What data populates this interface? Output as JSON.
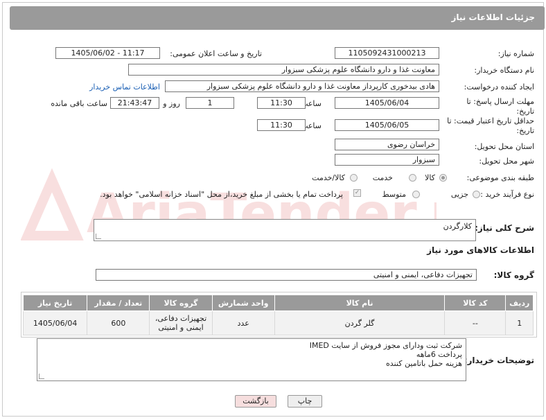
{
  "header": {
    "title": "جزئیات اطلاعات نیاز"
  },
  "form": {
    "need_number": {
      "label": "شماره نیاز:",
      "value": "1105092431000213"
    },
    "announce": {
      "label": "تاریخ و ساعت اعلان عمومی:",
      "value": "1405/06/02 - 11:17"
    },
    "buyer_org": {
      "label": "نام دستگاه خریدار:",
      "value": "معاونت غذا و دارو   دانشگاه علوم پزشکی سبزوار"
    },
    "creator": {
      "label": "ایجاد کننده درخواست:",
      "value": "هادی بیدخوری کارپرداز معاونت غذا و دارو   دانشگاه علوم پزشکی سبزوار",
      "contact_link": "اطلاعات تماس خریدار"
    },
    "deadline": {
      "label": "مهلت ارسال پاسخ: تا تاریخ:",
      "date": "1405/06/04",
      "time_label": "ساعت",
      "time": "11:30",
      "days": "1",
      "days_label": "روز و",
      "remaining": "21:43:47",
      "remaining_label": "ساعت باقی مانده"
    },
    "price_validity": {
      "label": "حداقل تاریخ اعتبار قیمت: تا تاریخ:",
      "date": "1405/06/05",
      "time_label": "ساعت",
      "time": "11:30"
    },
    "province": {
      "label": "استان محل تحویل:",
      "value": "خراسان رضوی"
    },
    "city": {
      "label": "شهر محل تحویل:",
      "value": "سبزوار"
    },
    "category": {
      "label": "طبقه بندی موضوعی:",
      "options": [
        "کالا",
        "خدمت",
        "کالا/خدمت"
      ],
      "selected": "کالا"
    },
    "process": {
      "label": "نوع فرآیند خرید :",
      "options": [
        "جزیی",
        "متوسط"
      ],
      "note": "پرداخت تمام یا بخشی از مبلغ خرید،از محل \"اسناد خزانه اسلامی\" خواهد بود."
    }
  },
  "description": {
    "label": "شرح کلی نیاز:",
    "value": "کلارگردن"
  },
  "goods": {
    "section_title": "اطلاعات کالاهای مورد نیاز",
    "group_label": "گروه کالا:",
    "group_value": "تجهیزات دفاعی، ایمنی و امنیتی",
    "columns": [
      "ردیف",
      "کد کالا",
      "نام کالا",
      "واحد شمارش",
      "گروه کالا",
      "تعداد / مقدار",
      "تاریخ نیاز"
    ],
    "rows": [
      {
        "index": "1",
        "code": "--",
        "name": "گلر گردن",
        "unit": "عدد",
        "group": "تجهیزات دفاعی، ایمنی و امنیتی",
        "qty": "600",
        "date": "1405/06/04"
      }
    ]
  },
  "buyer_notes": {
    "label": "توضیحات خریدار:",
    "lines": [
      "شرکت ثبت ودارای مجوز فروش از سایت IMED",
      "پرداخت 6ماهه",
      "هزینه حمل باتامین کننده"
    ]
  },
  "buttons": {
    "print": "چاپ",
    "back": "بازگشت"
  },
  "watermark": "AriaTender.neT",
  "colors": {
    "header": "#9a9a9a",
    "link": "#1a5fb4",
    "back_button": "#f6dede",
    "print_button": "#eeeeee"
  }
}
